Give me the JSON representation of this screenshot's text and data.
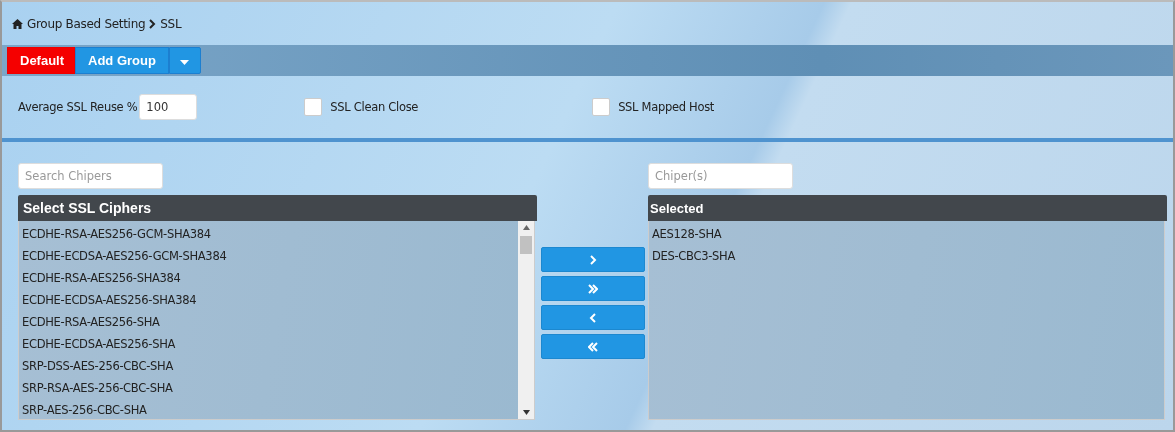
{
  "breadcrumb": [
    "Group Based Setting",
    "SSL"
  ],
  "toolbar": [
    {
      "kind": "danger",
      "label": "Default"
    },
    {
      "kind": "primary",
      "label": "Add Group"
    },
    {
      "kind": "dropdown"
    }
  ],
  "reuse": {
    "label": "Average SSL Reuse %",
    "value": "100"
  },
  "options": [
    {
      "label": "SSL Clean Close",
      "checked": false
    },
    {
      "label": "SSL Mapped Host",
      "checked": false
    }
  ],
  "available": {
    "search_placeholder": "Search Chipers",
    "title": "Select SSL Ciphers",
    "items": [
      "ECDHE-RSA-AES256-GCM-SHA384",
      "ECDHE-ECDSA-AES256-GCM-SHA384",
      "ECDHE-RSA-AES256-SHA384",
      "ECDHE-ECDSA-AES256-SHA384",
      "ECDHE-RSA-AES256-SHA",
      "ECDHE-ECDSA-AES256-SHA",
      "SRP-DSS-AES-256-CBC-SHA",
      "SRP-RSA-AES-256-CBC-SHA",
      "SRP-AES-256-CBC-SHA"
    ]
  },
  "transfer": [
    {
      "kind": "add"
    },
    {
      "kind": "add-all"
    },
    {
      "kind": "remove"
    },
    {
      "kind": "remove-all"
    }
  ],
  "selected": {
    "search_placeholder": "Chiper(s)",
    "title": "Selected",
    "items": [
      "AES128-SHA",
      "DES-CBC3-SHA"
    ]
  }
}
